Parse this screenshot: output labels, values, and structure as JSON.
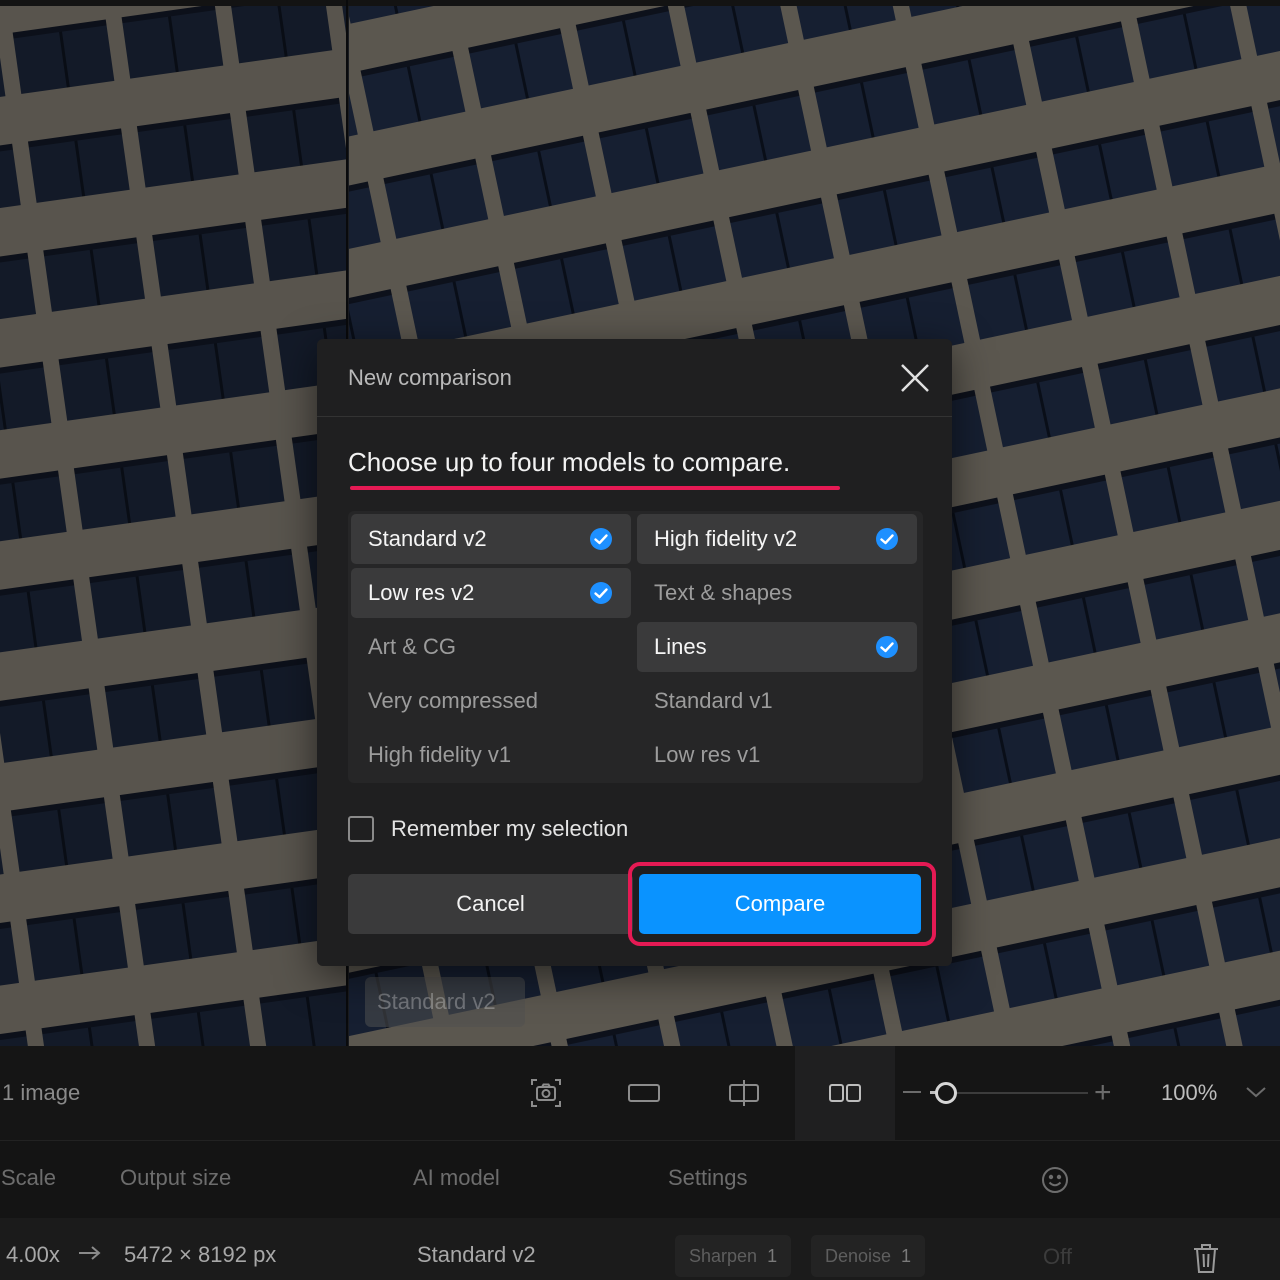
{
  "viewport": {
    "panel_label": "Standard v2"
  },
  "modal": {
    "title": "New comparison",
    "instruction": "Choose up to four models to compare.",
    "models": [
      {
        "label": "Standard v2",
        "selected": true
      },
      {
        "label": "High fidelity v2",
        "selected": true
      },
      {
        "label": "Low res v2",
        "selected": true
      },
      {
        "label": "Text & shapes",
        "selected": false
      },
      {
        "label": "Art & CG",
        "selected": false
      },
      {
        "label": "Lines",
        "selected": true
      },
      {
        "label": "Very compressed",
        "selected": false
      },
      {
        "label": "Standard v1",
        "selected": false
      },
      {
        "label": "High fidelity v1",
        "selected": false
      },
      {
        "label": "Low res v1",
        "selected": false
      }
    ],
    "remember_label": "Remember my selection",
    "remember_checked": false,
    "cancel_label": "Cancel",
    "compare_label": "Compare"
  },
  "toolbar": {
    "image_count": "1 image",
    "zoom_value": "100%",
    "zoom_level": 0.1
  },
  "table": {
    "headers": {
      "scale": "Scale",
      "output_size": "Output size",
      "ai_model": "AI model",
      "settings": "Settings"
    },
    "row": {
      "scale": "4.00x",
      "output_size": "5472 × 8192 px",
      "ai_model": "Standard v2",
      "sharpen_label": "Sharpen",
      "sharpen_value": "1",
      "denoise_label": "Denoise",
      "denoise_value": "1",
      "face_recovery": "Off"
    }
  },
  "colors": {
    "accent_blue": "#0a93ff",
    "highlight_pink": "#e51a54",
    "check_blue": "#1e90ff"
  }
}
